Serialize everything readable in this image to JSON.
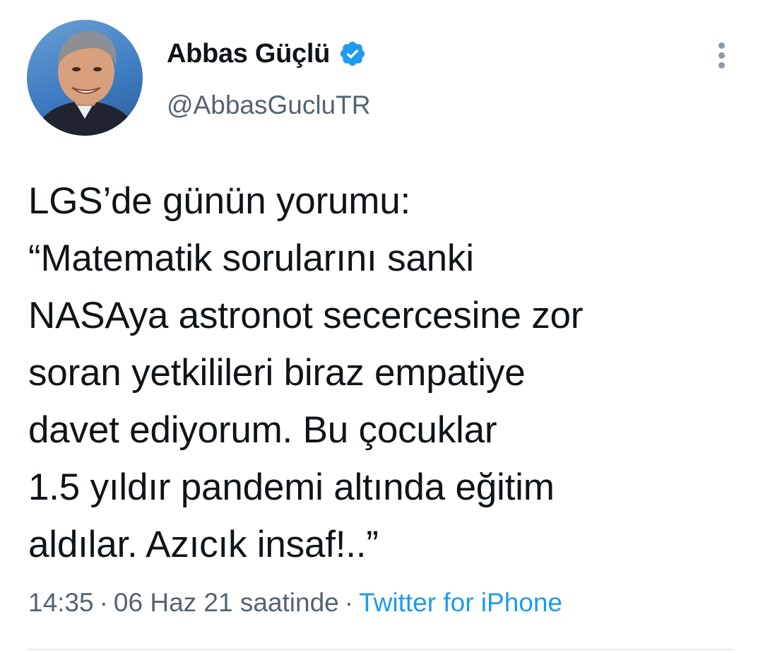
{
  "author": {
    "display_name": "Abbas Güçlü",
    "handle": "@AbbasGucluTR",
    "verified_icon": "verified-badge-icon",
    "avatar_icon": "avatar"
  },
  "menu": {
    "icon": "more-vertical-icon"
  },
  "tweet": {
    "text": "LGS’de günün yorumu:\n“Matematik sorularını sanki\nNASAya astronot secercesine zor\nsoran yetkilileri biraz empatiye\ndavet ediyorum. Bu çocuklar\n1.5 yıldır pandemi altında eğitim\naldılar. Azıcık insaf!..”"
  },
  "meta": {
    "time": "14:35",
    "separator": "·",
    "date": "06 Haz 21 saatinde",
    "source": "Twitter for iPhone"
  },
  "colors": {
    "text": "#0f1419",
    "secondary": "#536471",
    "accent": "#1d9bf0",
    "divider": "#e1e8ed"
  }
}
